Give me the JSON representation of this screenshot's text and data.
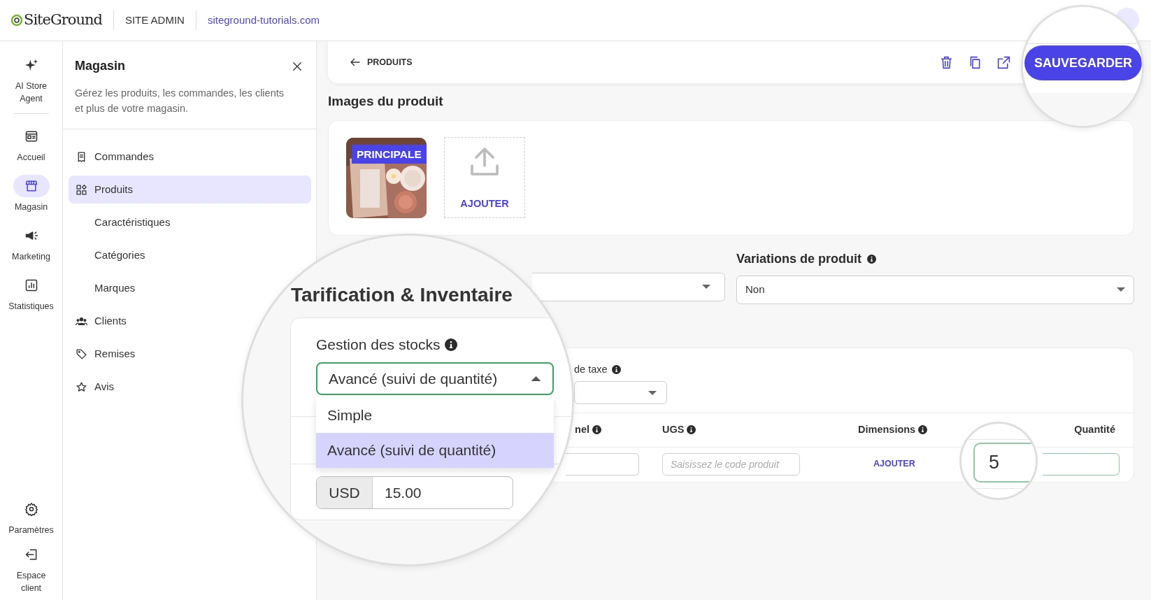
{
  "header": {
    "logo": "SiteGround",
    "section": "SITE ADMIN",
    "site": "siteground-tutorials.com"
  },
  "rail": {
    "top": [
      {
        "label": "AI Store Agent",
        "selected": false
      }
    ],
    "middle": [
      {
        "label": "Accueil",
        "selected": false
      },
      {
        "label": "Magasin",
        "selected": true
      },
      {
        "label": "Marketing",
        "selected": false
      },
      {
        "label": "Statistiques",
        "selected": false
      }
    ],
    "bottom": [
      {
        "label": "Paramètres",
        "selected": false
      },
      {
        "label": "Espace client",
        "selected": false
      }
    ]
  },
  "panel": {
    "title": "Magasin",
    "description": "Gérez les produits, les commandes, les clients et plus de votre magasin.",
    "menu": [
      {
        "label": "Commandes",
        "selected": false
      },
      {
        "label": "Produits",
        "selected": true,
        "children": [
          {
            "label": "Caractéristiques",
            "selected": false
          },
          {
            "label": "Catégories",
            "selected": false
          },
          {
            "label": "Marques",
            "selected": false
          }
        ]
      },
      {
        "label": "Clients",
        "selected": false
      },
      {
        "label": "Remises",
        "selected": false
      },
      {
        "label": "Avis",
        "selected": false
      }
    ]
  },
  "toolbar": {
    "back": "PRODUITS",
    "save": "SAUVEGARDER"
  },
  "images": {
    "title": "Images du produit",
    "badge": "PRINCIPALE",
    "add": "AJOUTER"
  },
  "variations": {
    "label": "Variations de produit",
    "value": "Non"
  },
  "pricing": {
    "title": "Tarification & Inventaire",
    "stock_label": "Gestion des stocks",
    "stock_value": "Avancé (suivi de quantité)",
    "expanded": true,
    "options": [
      {
        "label": "Simple",
        "selected": false
      },
      {
        "label": "Avancé (suivi de quantité)",
        "selected": true
      }
    ],
    "currency": "USD",
    "price": "15.00",
    "tax_label": "de taxe",
    "columns": [
      {
        "label": "nel",
        "info": true
      },
      {
        "label": "UGS",
        "info": true
      },
      {
        "label": "Dimensions",
        "info": true
      },
      {
        "label": "Quantité",
        "info": false
      }
    ],
    "sku_placeholder": "Saisissez le code produit",
    "dimensions_action": "AJOUTER",
    "quantity": "5"
  }
}
